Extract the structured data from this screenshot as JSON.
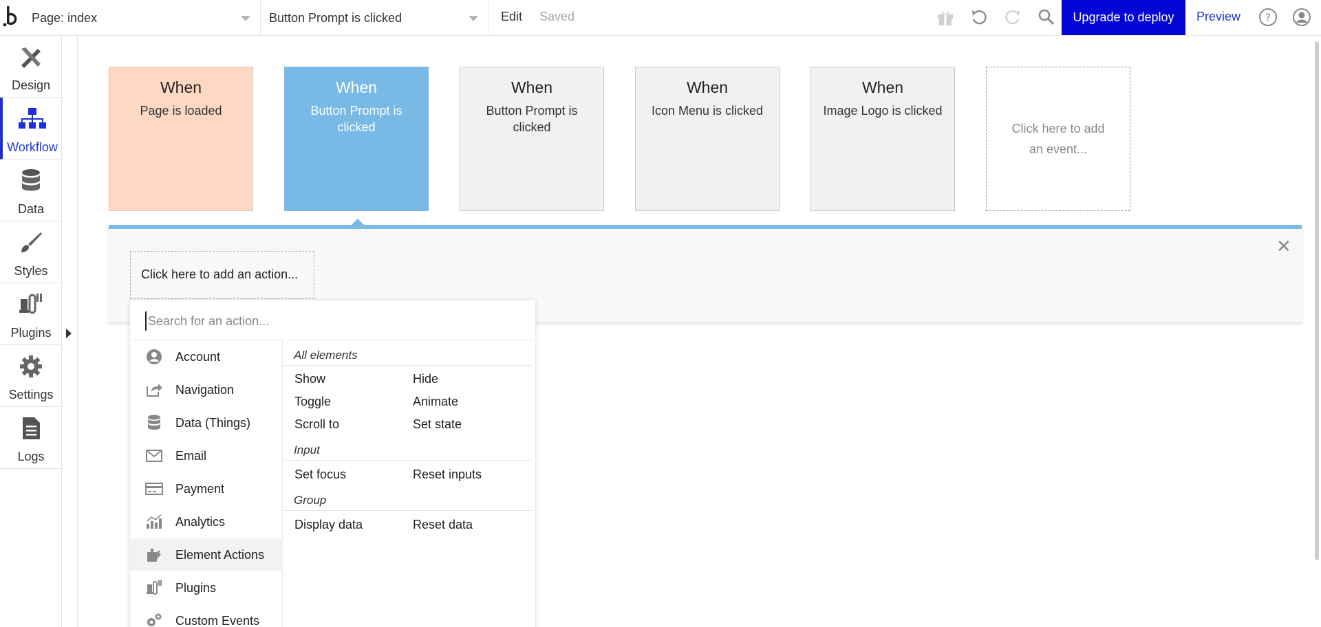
{
  "topbar": {
    "page_select": "Page: index",
    "event_select": "Button Prompt is clicked",
    "edit_label": "Edit",
    "saved_label": "Saved",
    "upgrade_label": "Upgrade to deploy",
    "preview_label": "Preview",
    "icons": [
      "gift-icon",
      "undo-icon",
      "redo-icon",
      "search-icon",
      "help-icon",
      "account-icon"
    ]
  },
  "sidebar": {
    "items": [
      {
        "label": "Design",
        "icon": "design-icon"
      },
      {
        "label": "Workflow",
        "icon": "workflow-icon",
        "active": true
      },
      {
        "label": "Data",
        "icon": "database-icon"
      },
      {
        "label": "Styles",
        "icon": "brush-icon"
      },
      {
        "label": "Plugins",
        "icon": "plug-icon"
      },
      {
        "label": "Settings",
        "icon": "gear-icon"
      },
      {
        "label": "Logs",
        "icon": "document-icon"
      }
    ]
  },
  "events": [
    {
      "when": "When",
      "desc": "Page is loaded",
      "state": "loaded"
    },
    {
      "when": "When",
      "desc": "Button Prompt is clicked",
      "state": "active"
    },
    {
      "when": "When",
      "desc": "Button Prompt is clicked",
      "state": "normal"
    },
    {
      "when": "When",
      "desc": "Icon Menu is clicked",
      "state": "normal"
    },
    {
      "when": "When",
      "desc": "Image Logo is clicked",
      "state": "normal"
    },
    {
      "desc": "Click here to add an event...",
      "state": "add"
    }
  ],
  "action_panel": {
    "add_action_label": "Click here to add an action...",
    "close_symbol": "✕"
  },
  "action_menu": {
    "search_placeholder": "Search for an action...",
    "categories": [
      {
        "label": "Account",
        "icon": "account-icon"
      },
      {
        "label": "Navigation",
        "icon": "navigation-icon"
      },
      {
        "label": "Data (Things)",
        "icon": "database-icon"
      },
      {
        "label": "Email",
        "icon": "email-icon"
      },
      {
        "label": "Payment",
        "icon": "credit-card-icon"
      },
      {
        "label": "Analytics",
        "icon": "analytics-icon"
      },
      {
        "label": "Element Actions",
        "icon": "element-actions-icon",
        "selected": true
      },
      {
        "label": "Plugins",
        "icon": "plug-icon"
      },
      {
        "label": "Custom Events",
        "icon": "gears-icon"
      }
    ],
    "groups": [
      {
        "name": "All elements",
        "actions": [
          "Show",
          "Hide",
          "Toggle",
          "Animate",
          "Scroll to",
          "Set state"
        ]
      },
      {
        "name": "Input",
        "actions": [
          "Set focus",
          "Reset inputs"
        ]
      },
      {
        "name": "Group",
        "actions": [
          "Display data",
          "Reset data"
        ]
      }
    ]
  },
  "colors": {
    "accent_blue": "#0205d3",
    "active_event": "#78b9e6",
    "loaded_event": "#fdd9c4",
    "panel_border": "#7cbbe8"
  }
}
